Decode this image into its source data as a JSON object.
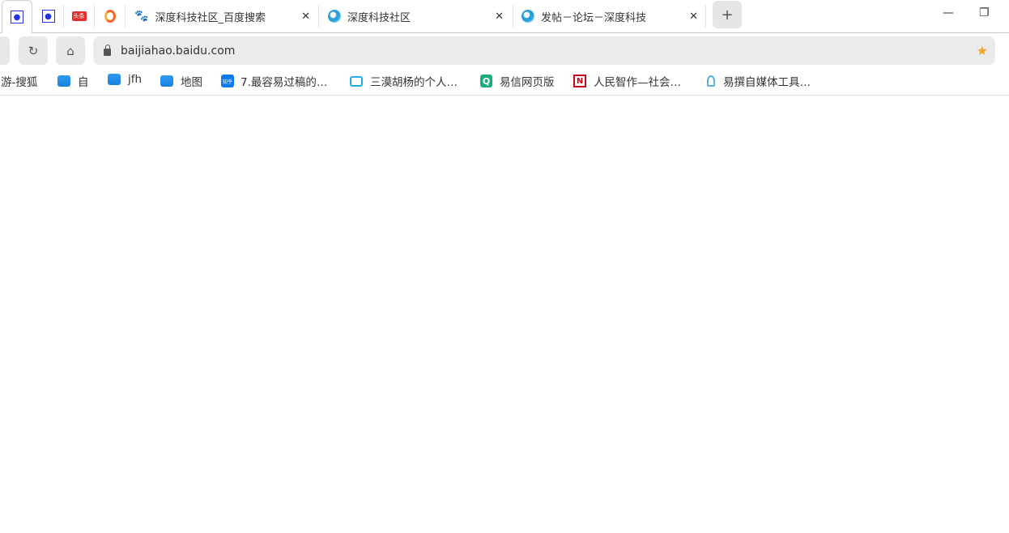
{
  "tabs": [
    {
      "type": "pinned",
      "icon": "baidu-paw-icon",
      "active": true
    },
    {
      "type": "pinned",
      "icon": "baidu-paw-icon"
    },
    {
      "type": "pinned",
      "icon": "toutiao-icon",
      "icon_text": "头条"
    },
    {
      "type": "pinned",
      "icon": "sohu-icon"
    },
    {
      "title": "深度科技社区_百度搜索",
      "icon": "baidu-paw-icon"
    },
    {
      "title": "深度科技社区",
      "icon": "deepin-icon"
    },
    {
      "title": "发帖－论坛－深度科技",
      "icon": "deepin-icon"
    }
  ],
  "close_glyph": "✕",
  "new_tab": "+",
  "window": {
    "minimize": "—",
    "restore": "❐"
  },
  "toolbar": {
    "reload": "↻",
    "home": "⌂",
    "url": "baijiahao.baidu.com",
    "bookmark_star": "★"
  },
  "bookmarks": [
    {
      "label": "游-搜狐"
    },
    {
      "label": "自",
      "icon": "folder-icon"
    },
    {
      "label": "jfh",
      "icon": "folder-icon"
    },
    {
      "label": "地图",
      "icon": "folder-icon"
    },
    {
      "label": "7.最容易过稿的…",
      "icon": "zhihu-icon",
      "icon_text": "知乎"
    },
    {
      "label": "三漠胡杨的个人…",
      "icon": "bilibili-icon"
    },
    {
      "label": "易信网页版",
      "icon": "yixin-icon",
      "icon_text": "Q"
    },
    {
      "label": "人民智作—社会…",
      "icon": "renmin-icon",
      "icon_text": "N"
    },
    {
      "label": "易撰自媒体工具…",
      "icon": "yizhuan-icon"
    }
  ]
}
